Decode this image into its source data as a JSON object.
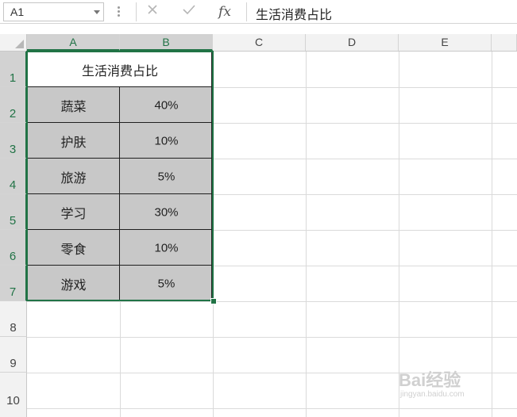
{
  "formula_bar": {
    "name_box": "A1",
    "cancel_icon": "close-x-icon",
    "enter_icon": "check-icon",
    "function_icon": "fx",
    "content": "生活消费占比"
  },
  "columns": [
    "A",
    "B",
    "C",
    "D",
    "E"
  ],
  "rows": [
    "1",
    "2",
    "3",
    "4",
    "5",
    "6",
    "7",
    "8",
    "9",
    "10"
  ],
  "sheet": {
    "title": "生活消费占比",
    "data": [
      {
        "category": "蔬菜",
        "percent": "40%"
      },
      {
        "category": "护肤",
        "percent": "10%"
      },
      {
        "category": "旅游",
        "percent": "5%"
      },
      {
        "category": "学习",
        "percent": "30%"
      },
      {
        "category": "零食",
        "percent": "10%"
      },
      {
        "category": "游戏",
        "percent": "5%"
      }
    ]
  },
  "colors": {
    "selection": "#217346",
    "data_fill": "#c8c8c8"
  },
  "watermark": {
    "text": "Bai经验",
    "url": "jingyan.baidu.com"
  }
}
